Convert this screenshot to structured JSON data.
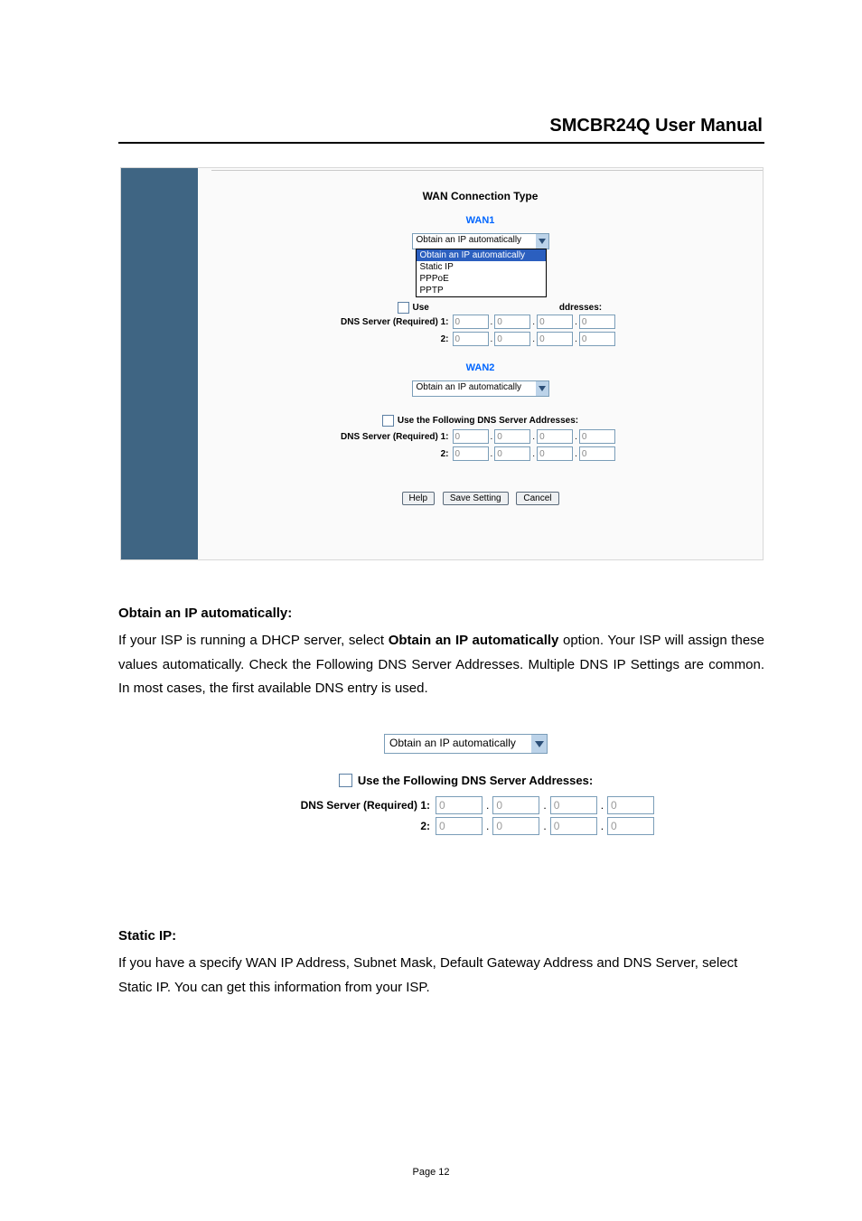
{
  "header": {
    "title": "SMCBR24Q User Manual"
  },
  "footer": {
    "page_label": "Page 12"
  },
  "shot1": {
    "title": "WAN Connection Type",
    "wan1": {
      "name": "WAN1",
      "select": {
        "selected": "Obtain an IP automatically",
        "options": [
          "Obtain an IP automatically",
          "Static IP",
          "PPPoE",
          "PPTP"
        ]
      },
      "use_following_prefix": "Use",
      "use_following_suffix": "ddresses:",
      "dns_label_1": "DNS Server (Required) 1:",
      "dns_label_2": "2:",
      "ip_zero": "0"
    },
    "wan2": {
      "name": "WAN2",
      "select": {
        "selected": "Obtain an IP automatically"
      },
      "use_following": "Use the Following DNS Server Addresses:",
      "dns_label_1": "DNS Server (Required) 1:",
      "dns_label_2": "2:",
      "ip_zero": "0"
    },
    "buttons": {
      "help": "Help",
      "save": "Save Setting",
      "cancel": "Cancel"
    }
  },
  "text": {
    "obtain_heading": "Obtain an IP automatically",
    "obtain_colon": ":",
    "obtain_p_a": "If your ISP is running a DHCP server, select ",
    "obtain_bold": "Obtain an IP automatically",
    "obtain_p_b": " option. Your ISP will assign these values automatically. Check the Following DNS Server Addresses. Multiple DNS IP Settings are common. In most cases, the first available DNS entry is used.",
    "static_heading": "Static IP:",
    "static_p": "If you have a specify WAN IP Address, Subnet Mask, Default Gateway Address and DNS Server, select Static IP. You can get this information from your ISP."
  },
  "shot2": {
    "select": {
      "selected": "Obtain an IP automatically"
    },
    "use_following": "Use the Following DNS Server Addresses:",
    "dns_label_1": "DNS Server (Required) 1:",
    "dns_label_2": "2:",
    "ip_zero": "0"
  }
}
